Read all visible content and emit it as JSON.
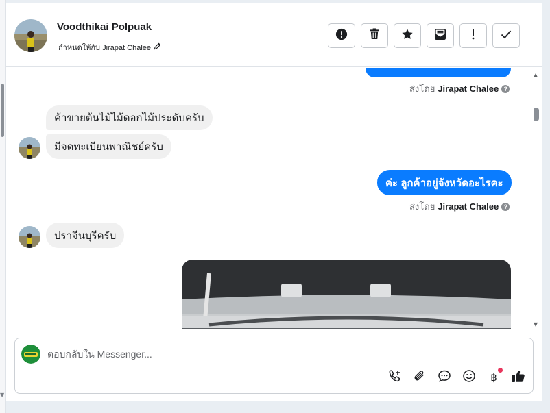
{
  "header": {
    "contact_name": "Voodthikai Polpuak",
    "assigned_label": "กำหนดให้กับ Jirapat Chalee",
    "toolbar": [
      {
        "name": "spam-button",
        "icon": "alert-circle-icon"
      },
      {
        "name": "delete-button",
        "icon": "trash-icon"
      },
      {
        "name": "star-button",
        "icon": "star-icon"
      },
      {
        "name": "mark-unread-button",
        "icon": "envelope-icon"
      },
      {
        "name": "follow-up-button",
        "icon": "exclamation-icon"
      },
      {
        "name": "done-button",
        "icon": "check-icon"
      }
    ]
  },
  "thread": {
    "sent_by_prefix": "ส่งโดย",
    "sent_by_name": "Jirapat Chalee",
    "messages": [
      {
        "dir": "in",
        "text": "ค้าขายต้นไม้ไม้ดอกไม้ประดับครับ"
      },
      {
        "dir": "in",
        "text": "มีจดทะเบียนพาณิชย์ครับ"
      },
      {
        "dir": "out",
        "text": "ค่ะ ลูกค้าอยู่จังหวัดอะไรคะ"
      },
      {
        "dir": "in",
        "text": "ปราจีนบุรีครับ"
      }
    ]
  },
  "composer": {
    "placeholder": "ตอบกลับใน Messenger...",
    "value": "",
    "baht_symbol": "฿"
  },
  "colors": {
    "outgoing_bubble": "#0a7cff",
    "incoming_bubble": "#f0f0f0",
    "notification_dot": "#e8365d"
  }
}
